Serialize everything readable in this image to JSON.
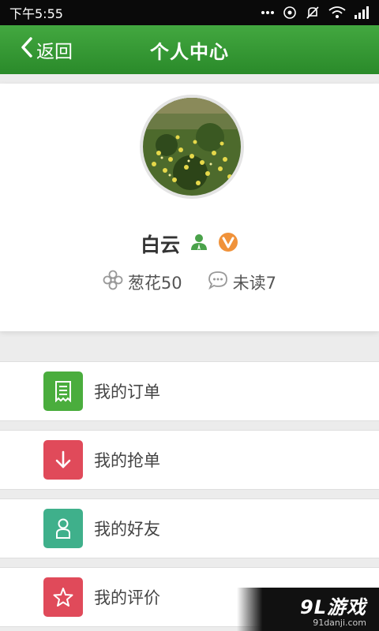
{
  "status_bar": {
    "time": "下午5:55",
    "icons": [
      "dots-icon",
      "location-icon",
      "mute-icon",
      "wifi-icon",
      "signal-icon"
    ]
  },
  "header": {
    "back_label": "返回",
    "title": "个人中心"
  },
  "profile": {
    "name": "白云",
    "badges": [
      "user-verified-icon",
      "vip-v-badge"
    ],
    "points_label": "葱花50",
    "unread_label": "未读7"
  },
  "menu": [
    {
      "label": "我的订单",
      "icon": "receipt-icon",
      "color": "#4aad3d"
    },
    {
      "label": "我的抢单",
      "icon": "arrow-down-icon",
      "color": "#e04a5a"
    },
    {
      "label": "我的好友",
      "icon": "person-icon",
      "color": "#3fb08b"
    },
    {
      "label": "我的评价",
      "icon": "star-icon",
      "color": "#e04a5a"
    }
  ],
  "watermark": {
    "main": "9L游戏",
    "sub": "91danji.com"
  },
  "colors": {
    "header_green": "#2f922d",
    "vip_orange": "#f0923a",
    "verified_green": "#4aa24a"
  }
}
